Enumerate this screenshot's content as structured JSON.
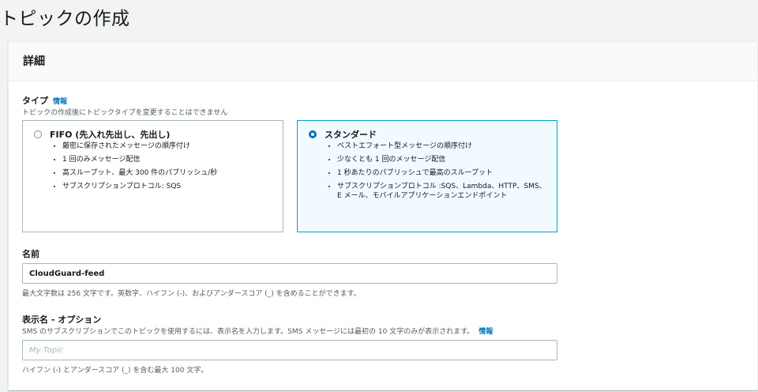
{
  "page": {
    "title": "トピックの作成"
  },
  "details": {
    "title": "詳細",
    "type": {
      "label": "タイプ",
      "info": "情報",
      "description": "トピックの作成後にトピックタイプを変更することはできません",
      "options": [
        {
          "title": "FIFO (先入れ先出し、先出し)",
          "selected": false,
          "bullets": [
            "厳密に保存されたメッセージの順序付け",
            "1 回のみメッセージ配信",
            "高スループット、最大 300 件のパブリッシュ/秒",
            "サブスクリプションプロトコル: SQS"
          ]
        },
        {
          "title": "スタンダード",
          "selected": true,
          "bullets": [
            "ベストエフォート型メッセージの順序付け",
            "少なくとも 1 回のメッセージ配信",
            "1 秒あたりのパブリッシュで最高のスループット",
            "サブスクリプションプロトコル :SQS、Lambda、HTTP、SMS、E メール、モバイルアプリケーションエンドポイント"
          ]
        }
      ]
    },
    "name": {
      "label": "名前",
      "value": "CloudGuard-feed",
      "help": "最大文字数は 256 文字です。英数字、ハイフン (-)、およびアンダースコア (_) を含めることができます。"
    },
    "display_name": {
      "label": "表示名 - オプション",
      "description": "SMS のサブスクリプションでこのトピックを使用するには、表示名を入力します。SMS メッセージには最初の 10 文字のみが表示されます。",
      "info": "情報",
      "placeholder": "My Topic",
      "value": "",
      "help": "ハイフン (-) とアンダースコア (_) を含む最大 100 文字。"
    }
  },
  "colors": {
    "accent": "#0073bb",
    "selected_border": "#00a1c9",
    "selected_bg": "#f1faff"
  }
}
